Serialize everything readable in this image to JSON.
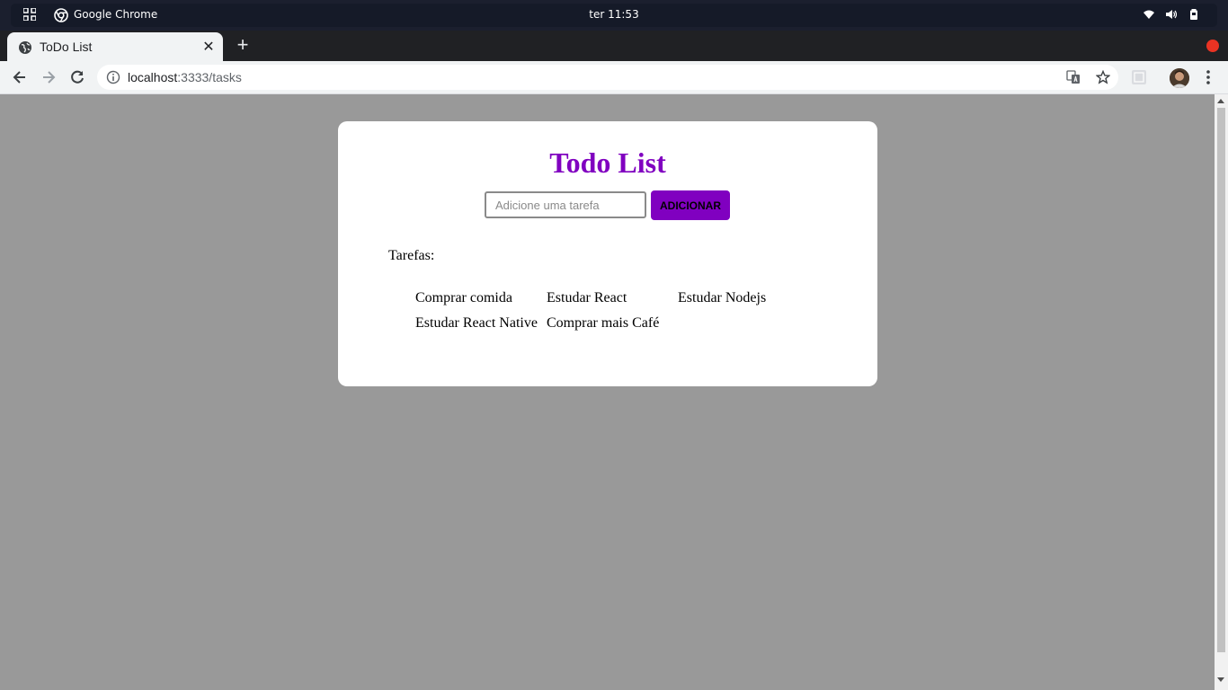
{
  "system_bar": {
    "app_name": "Google Chrome",
    "clock": "ter 11:53"
  },
  "browser": {
    "tab": {
      "title": "ToDo List",
      "close_glyph": "✕"
    },
    "new_tab_glyph": "+",
    "url": {
      "host": "localhost",
      "path": ":3333/tasks"
    }
  },
  "page": {
    "title": "Todo List",
    "input": {
      "placeholder": "Adicione uma tarefa",
      "value": ""
    },
    "add_button_label": "ADICIONAR",
    "tasks_label": "Tarefas:",
    "tasks": [
      "Comprar comida",
      "Estudar React",
      "Estudar Nodejs",
      "Estudar React Native",
      "Comprar mais Café"
    ]
  },
  "colors": {
    "accent": "#8000c0",
    "background": "#999999",
    "card": "#ffffff",
    "system_bar": "#1b1f2e",
    "tab_strip": "#202124",
    "toolbar": "#f1f3f4",
    "record_indicator": "#ea3323"
  },
  "icons": {
    "system_bar": [
      "apps-grid-icon",
      "chrome-logo-icon",
      "wifi-icon",
      "volume-icon",
      "battery-icon"
    ],
    "toolbar": [
      "back-arrow-icon",
      "forward-arrow-icon",
      "reload-icon",
      "info-icon",
      "translate-icon",
      "star-icon",
      "extension-icon",
      "avatar",
      "more-vert-icon"
    ]
  }
}
